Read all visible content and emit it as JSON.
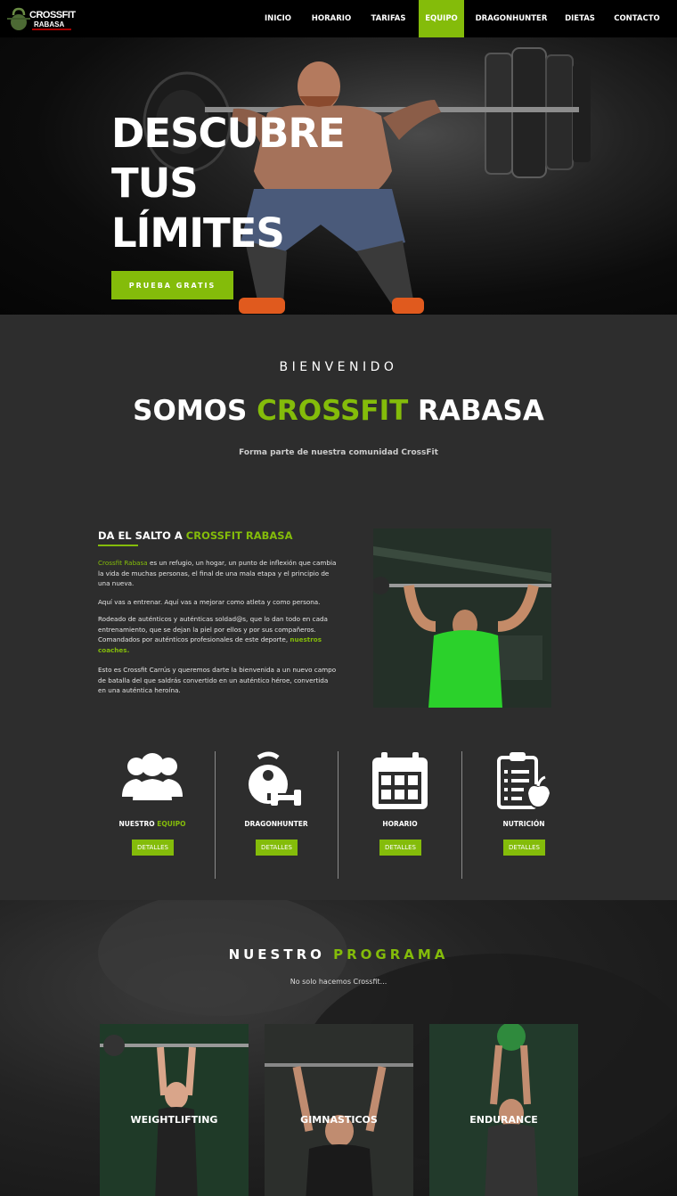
{
  "nav": {
    "logo_text": "CROSSFIT",
    "logo_sub": "RABASA",
    "items": [
      {
        "label": "INICIO",
        "active": false
      },
      {
        "label": "HORARIO",
        "active": false
      },
      {
        "label": "TARIFAS",
        "active": false
      },
      {
        "label": "EQUIPO",
        "active": true
      },
      {
        "label": "DRAGONHUNTER",
        "active": false
      },
      {
        "label": "DIETAS",
        "active": false
      },
      {
        "label": "CONTACTO",
        "active": false
      }
    ]
  },
  "hero": {
    "line1": "DESCUBRE",
    "line2": "TUS",
    "line3": "LÍMITES",
    "cta": "PRUEBA GRATIS"
  },
  "welcome": {
    "kicker": "BIENVENIDO",
    "title_a": "SOMOS ",
    "title_b": "CROSSFIT",
    "title_c": " RABASA",
    "subtitle": "Forma parte de nuestra comunidad CrossFit"
  },
  "about": {
    "title_a": "DA EL SALTO A ",
    "title_b": "CROSSFIT RABASA",
    "p1_link": "Crossfit Rabasa",
    "p1_rest": " es un refugio, un hogar, un punto de inflexión que cambia la vida de muchas personas, el final de una mala etapa y el principio de una nueva.",
    "p2": "Aquí vas a entrenar. Aquí vas a mejorar como atleta y como persona.",
    "p3_text": "Rodeado de auténticos y auténticas soldad@s, que lo dan todo en cada entrenamiento, que se dejan la piel por ellos y por sus compañeros. Comandados por auténticos profesionales de este deporte, ",
    "p3_link": "nuestros coaches.",
    "p4": "Esto es Crossfit Carrús y queremos darte la bienvenida a un nuevo campo de batalla del que saldrás convertido en un auténtico héroe, convertida en una auténtica heroína."
  },
  "features": [
    {
      "label_a": "NUESTRO ",
      "label_b": "EQUIPO",
      "button": "DETALLES",
      "icon": "users-icon"
    },
    {
      "label_a": "DRAGONHUNTER",
      "label_b": "",
      "button": "DETALLES",
      "icon": "kettlebell-icon"
    },
    {
      "label_a": "HORARIO",
      "label_b": "",
      "button": "DETALLES",
      "icon": "calendar-icon"
    },
    {
      "label_a": "NUTRICIÓN",
      "label_b": "",
      "button": "DETALLES",
      "icon": "nutrition-icon"
    }
  ],
  "program": {
    "title_a": "NUESTRO ",
    "title_b": "PROGRAMA",
    "subtitle": "No solo hacemos Crossfit...",
    "cards": [
      {
        "label": "WEIGHTLIFTING"
      },
      {
        "label": "GIMNASTICOS"
      },
      {
        "label": "ENDURANCE"
      }
    ]
  },
  "colors": {
    "accent": "#84bc0a",
    "dark": "#2d2d2d",
    "nav": "#000000"
  }
}
